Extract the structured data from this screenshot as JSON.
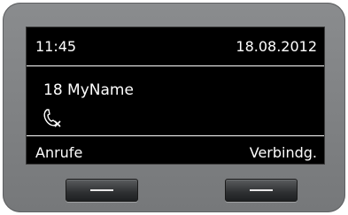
{
  "status": {
    "time": "11:45",
    "date": "18.08.2012"
  },
  "call": {
    "caller": "18 MyName",
    "icon": "missed-call-icon"
  },
  "softkeys": {
    "left_label": "Anrufe",
    "right_label": "Verbindg."
  },
  "colors": {
    "bezel": "#808284",
    "screen": "#000000",
    "text": "#ffffff"
  }
}
